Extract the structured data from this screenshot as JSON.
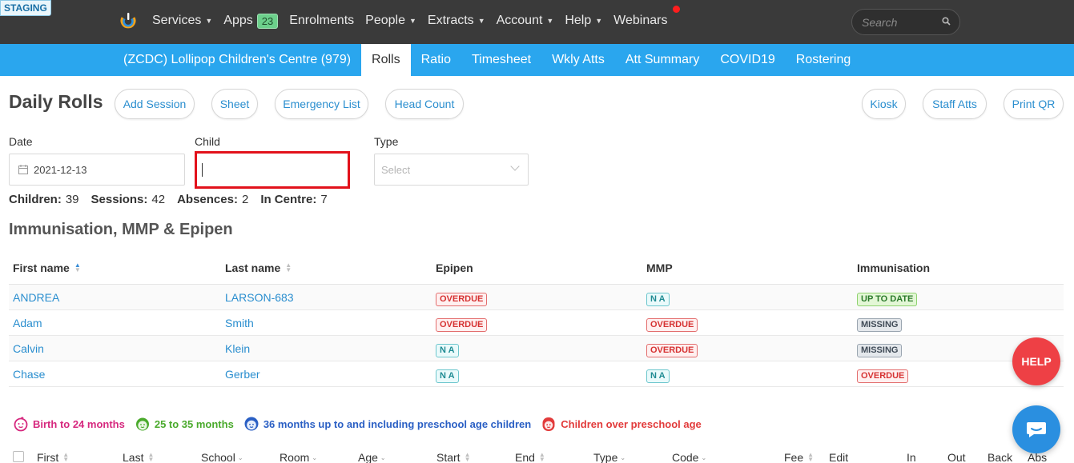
{
  "env_badge": "STAGING",
  "topnav": {
    "items": [
      {
        "label": "Services",
        "caret": true
      },
      {
        "label": "Apps",
        "badge": "23"
      },
      {
        "label": "Enrolments",
        "caret": false
      },
      {
        "label": "People",
        "caret": true
      },
      {
        "label": "Extracts",
        "caret": true
      },
      {
        "label": "Account",
        "caret": true
      },
      {
        "label": "Help",
        "caret": true
      },
      {
        "label": "Webinars",
        "caret": false
      }
    ],
    "search_placeholder": "Search"
  },
  "subnav": {
    "centre": "(ZCDC) Lollipop Children's Centre (979)",
    "tabs": [
      "Rolls",
      "Ratio",
      "Timesheet",
      "Wkly Atts",
      "Att Summary",
      "COVID19",
      "Rostering"
    ],
    "active_tab": "Rolls"
  },
  "page": {
    "title": "Daily Rolls",
    "left_buttons": [
      "Add Session",
      "Sheet",
      "Emergency List",
      "Head Count"
    ],
    "right_buttons": [
      "Kiosk",
      "Staff Atts",
      "Print QR"
    ]
  },
  "filters": {
    "date_label": "Date",
    "date_value": "2021-12-13",
    "child_label": "Child",
    "child_value": "",
    "type_label": "Type",
    "type_placeholder": "Select"
  },
  "summary": {
    "children_label": "Children:",
    "children": "39",
    "sessions_label": "Sessions:",
    "sessions": "42",
    "absences_label": "Absences:",
    "absences": "2",
    "in_centre_label": "In Centre:",
    "in_centre": "7"
  },
  "section_title": "Immunisation, MMP & Epipen",
  "imm_table": {
    "columns": [
      "First name",
      "Last name",
      "Epipen",
      "MMP",
      "Immunisation"
    ],
    "rows": [
      {
        "first": "ANDREA",
        "last": "LARSON-683",
        "epipen": "OVERDUE",
        "mmp": "N A",
        "imm": "UP TO DATE"
      },
      {
        "first": "Adam",
        "last": "Smith",
        "epipen": "OVERDUE",
        "mmp": "OVERDUE",
        "imm": "MISSING"
      },
      {
        "first": "Calvin",
        "last": "Klein",
        "epipen": "N A",
        "mmp": "OVERDUE",
        "imm": "MISSING"
      },
      {
        "first": "Chase",
        "last": "Gerber",
        "epipen": "N A",
        "mmp": "N A",
        "imm": "OVERDUE"
      }
    ]
  },
  "legend": [
    {
      "label": "Birth to 24 months",
      "color": "#d6287e"
    },
    {
      "label": "25 to 35 months",
      "color": "#4aaa2c"
    },
    {
      "label": "36 months up to and including preschool age children",
      "color": "#2a5fc4"
    },
    {
      "label": "Children over preschool age",
      "color": "#e23b3b"
    }
  ],
  "roll_columns": [
    "First",
    "Last",
    "School",
    "Room",
    "Age",
    "Start",
    "End",
    "Type",
    "Code",
    "Fee",
    "Edit",
    "In",
    "Out",
    "Back",
    "Abs"
  ],
  "help_label": "HELP",
  "colors": {
    "topnav": "#3a3a3a",
    "subnav": "#2aa6ee",
    "help": "#ee4045",
    "chat": "#2a8fe0"
  }
}
